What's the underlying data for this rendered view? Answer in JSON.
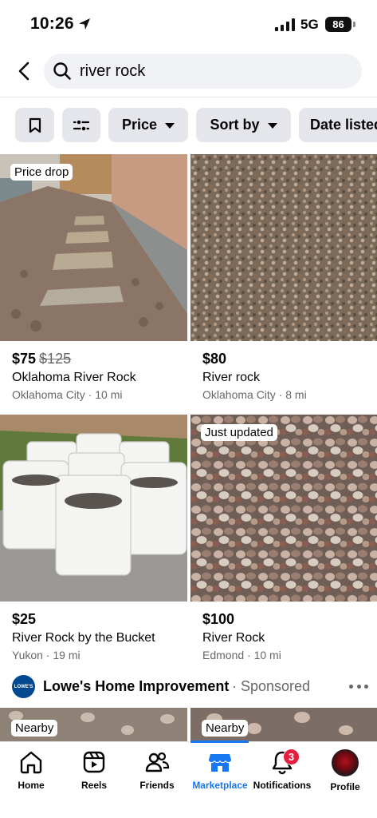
{
  "status_bar": {
    "time": "10:26",
    "network": "5G",
    "battery": "86"
  },
  "search": {
    "query": "river rock"
  },
  "filters": [
    {
      "label": "Price"
    },
    {
      "label": "Sort by"
    },
    {
      "label": "Date listed"
    }
  ],
  "listings": [
    {
      "badge": "Price drop",
      "price": "$75",
      "old_price": "$125",
      "title": "Oklahoma River Rock",
      "location": "Oklahoma City · 10 mi"
    },
    {
      "badge": "",
      "price": "$80",
      "old_price": "",
      "title": "River rock",
      "location": "Oklahoma City · 8 mi"
    },
    {
      "badge": "",
      "price": "$25",
      "old_price": "",
      "title": "River Rock by the Bucket",
      "location": "Yukon · 19 mi"
    },
    {
      "badge": "Just updated",
      "price": "$100",
      "old_price": "",
      "title": "River Rock",
      "location": "Edmond · 10 mi"
    }
  ],
  "sponsored": {
    "logo_text": "LOWE'S",
    "name": "Lowe's Home Improvement",
    "tag": "· Sponsored",
    "ads": [
      {
        "badge": "Nearby"
      },
      {
        "badge": "Nearby"
      }
    ]
  },
  "tabs": [
    {
      "label": "Home",
      "icon": "home-icon"
    },
    {
      "label": "Reels",
      "icon": "reels-icon"
    },
    {
      "label": "Friends",
      "icon": "friends-icon"
    },
    {
      "label": "Marketplace",
      "icon": "marketplace-icon",
      "active": true
    },
    {
      "label": "Notifications",
      "icon": "bell-icon",
      "badge": "3"
    },
    {
      "label": "Profile",
      "icon": "avatar"
    }
  ],
  "colors": {
    "accent": "#1877f2",
    "badge_red": "#e41e3f",
    "chip_bg": "#e4e6eb",
    "search_bg": "#f0f2f5",
    "secondary_text": "#65676b"
  }
}
